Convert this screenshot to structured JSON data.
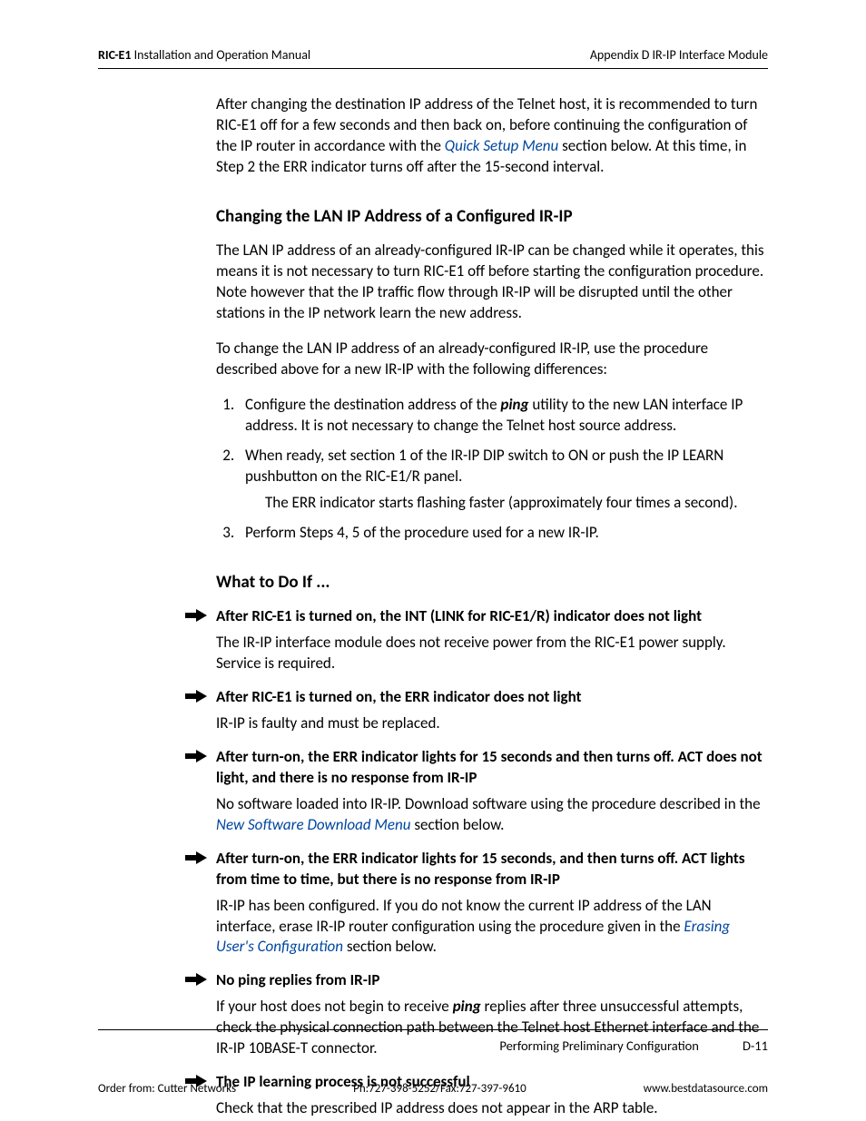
{
  "header": {
    "left_bold": "RIC-E1",
    "left_rest": " Installation and Operation Manual",
    "right": "Appendix D  IR-IP Interface Module"
  },
  "intro": {
    "p1a": "After changing the destination IP address of the Telnet host, it is recommended to turn RIC-E1 off for a few seconds and then back on, before continuing the configuration of the IP router in accordance with the ",
    "link": "Quick Setup Menu",
    "p1b": " section below. At this time, in Step 2 the ERR indicator turns off after the 15-second interval."
  },
  "section1": {
    "title": "Changing the LAN IP Address of a Configured IR-IP",
    "p1": "The LAN IP address of an already-configured IR-IP can be changed while it operates, this means it is not necessary to turn RIC-E1 off before starting the configuration procedure. Note however that the IP traffic flow through IR-IP will be disrupted until the other stations in the IP network learn the new address.",
    "p2": "To change the LAN IP address of an already-configured IR-IP, use the procedure described above for a new IR-IP with the following differences:",
    "steps": [
      {
        "a": "Configure the destination address of the ",
        "em": "ping",
        "b": " utility to the new LAN interface IP address. It is not necessary to change the Telnet host source address."
      },
      {
        "text": "When ready, set section 1 of the IR-IP DIP switch to ON or push the IP LEARN pushbutton on the RIC-E1/R panel.",
        "sub": "The ERR indicator starts flashing faster (approximately four times a second)."
      },
      {
        "text": "Perform Steps 4, 5 of the procedure used for a new IR-IP."
      }
    ]
  },
  "section2": {
    "title": "What to Do If ...",
    "items": [
      {
        "title": "After RIC-E1 is turned on, the INT (LINK for RIC-E1/R) indicator does not light",
        "body": "The IR-IP interface module does not receive power from the RIC-E1 power supply. Service is required."
      },
      {
        "title": "After RIC-E1 is turned on, the ERR indicator does not light",
        "body": "IR-IP is faulty and must be replaced."
      },
      {
        "title": "After turn-on, the ERR indicator lights for 15 seconds and then turns off. ACT does not light, and there is no response from IR-IP",
        "body_a": "No software loaded into IR-IP. Download software using the procedure described in the ",
        "link": "New Software Download Menu",
        "body_b": " section below."
      },
      {
        "title": "After turn-on, the ERR indicator lights for 15 seconds, and then turns off. ACT lights from time to time, but there is no response from IR-IP",
        "body_a": "IR-IP has been configured. If you do not know the current IP address of the LAN interface, erase IR-IP router configuration using the procedure given in the ",
        "link": "Erasing User's Configuration",
        "body_b": " section below."
      },
      {
        "title": "No ping replies from IR-IP",
        "body_a": "If your host does not begin to receive ",
        "em": "ping",
        "body_b": " replies after three unsuccessful attempts, check the physical connection path between the Telnet host Ethernet interface and the IR-IP 10BASE-T connector."
      },
      {
        "title": "The IP learning process is not successful",
        "body": "Check that the prescribed IP address does not appear in the ARP table."
      }
    ]
  },
  "footer_top": {
    "section": "Performing Preliminary Configuration",
    "page": "D-11"
  },
  "footer_bottom": {
    "left": "Order from: Cutter Networks",
    "center": "Ph:727-398-5252/Fax:727-397-9610",
    "right": "www.bestdatasource.com"
  }
}
